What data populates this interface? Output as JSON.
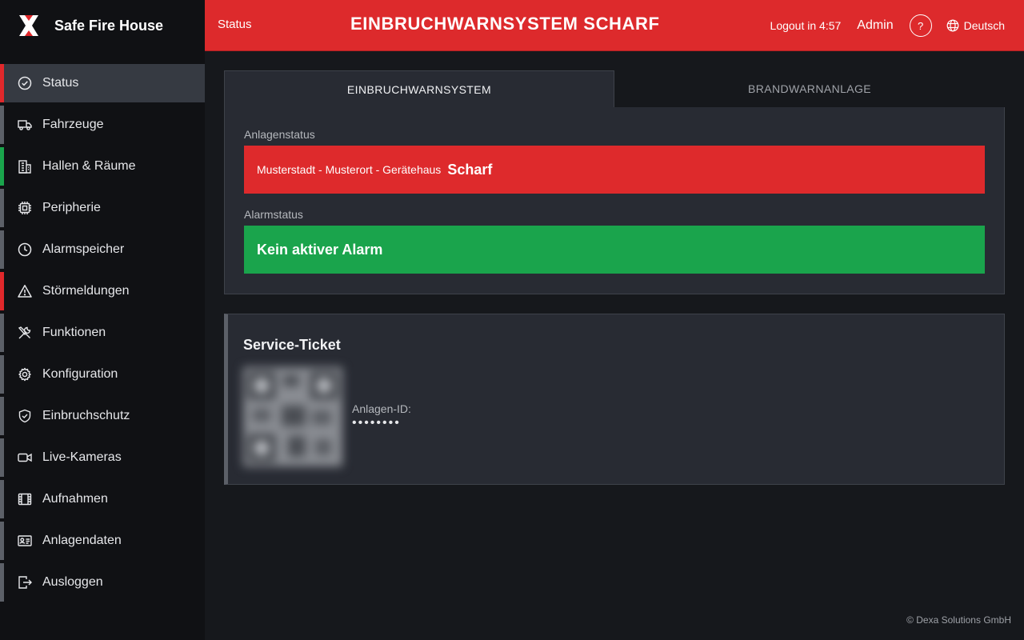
{
  "brand": {
    "name": "Safe Fire House",
    "logo_icon": "x-logo-icon"
  },
  "sidebar": {
    "items": [
      {
        "label": "Status",
        "icon": "check-circle-icon",
        "state": "active"
      },
      {
        "label": "Fahrzeuge",
        "icon": "truck-icon",
        "state": "gray"
      },
      {
        "label": "Hallen & Räume",
        "icon": "building-icon",
        "state": "green"
      },
      {
        "label": "Peripherie",
        "icon": "chip-icon",
        "state": "gray"
      },
      {
        "label": "Alarmspeicher",
        "icon": "clock-icon",
        "state": "gray"
      },
      {
        "label": "Störmeldungen",
        "icon": "warning-triangle-icon",
        "state": "red"
      },
      {
        "label": "Funktionen",
        "icon": "tools-icon",
        "state": "gray"
      },
      {
        "label": "Konfiguration",
        "icon": "gear-icon",
        "state": "gray"
      },
      {
        "label": "Einbruchschutz",
        "icon": "shield-icon",
        "state": "gray"
      },
      {
        "label": "Live-Kameras",
        "icon": "video-camera-icon",
        "state": "gray"
      },
      {
        "label": "Aufnahmen",
        "icon": "film-icon",
        "state": "gray"
      },
      {
        "label": "Anlagendaten",
        "icon": "id-card-icon",
        "state": "gray"
      },
      {
        "label": "Ausloggen",
        "icon": "logout-icon",
        "state": "gray"
      }
    ]
  },
  "header": {
    "breadcrumb": "Status",
    "title": "EINBRUCHWARNSYSTEM SCHARF",
    "logout_timer": "Logout in 4:57",
    "user": "Admin",
    "help": "?",
    "language": "Deutsch"
  },
  "tabs": [
    {
      "label": "EINBRUCHWARNSYSTEM",
      "active": true
    },
    {
      "label": "BRANDWARNANLAGE",
      "active": false
    }
  ],
  "panel": {
    "system_label": "Anlagenstatus",
    "location": "Musterstadt - Musterort - Gerätehaus",
    "system_state": "Scharf",
    "alarm_label": "Alarmstatus",
    "alarm_state": "Kein aktiver Alarm"
  },
  "ticket": {
    "title": "Service-Ticket",
    "id_label": "Anlagen-ID:",
    "id_value": "••••••••"
  },
  "footer": {
    "copyright": "© Dexa Solutions GmbH"
  },
  "colors": {
    "header_red": "#dd2a2c",
    "status_green": "#1aa44c",
    "sidebar_bg": "#101114",
    "panel_bg": "#282b33"
  }
}
